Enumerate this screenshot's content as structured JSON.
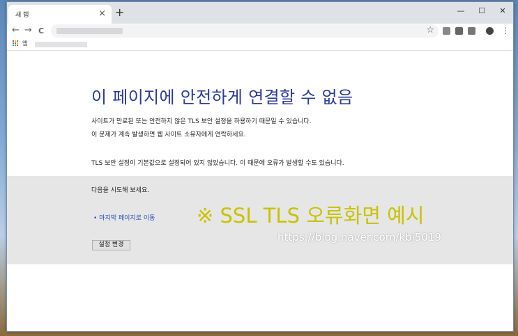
{
  "browser": {
    "tab_title": "새 탭",
    "tab_close": "×",
    "new_tab": "+",
    "back": "←",
    "forward": "→",
    "reload": "C",
    "star": "☆",
    "window_controls": {
      "minimize": "—",
      "maximize": "☐",
      "close": "✕"
    },
    "bookmarks_label": "앱",
    "menu": "⋮"
  },
  "error_page": {
    "title": "이 페이지에 안전하게 연결할 수 없음",
    "line1": "사이트가 만료된 또는 안전하지 않은 TLS 보안 설정을 하용하기 때문일 수 있습니다.",
    "line2": "이 문제가 계속 발생하면 웹 사이트 소유자에게 연락하세요.",
    "line3": "TLS 보안 설정이 기본값으로 설정되어 있지 않았습니다. 이 때문에 오류가 발생할 수도 있습니다.",
    "try_label": "다음을 시도해 보세요.",
    "link_last_page": "• 마지막 페이지로 이동",
    "button_change_settings": "설정 변경"
  },
  "overlay": {
    "caption": "※ SSL TLS 오류화면 예시",
    "watermark": "https://blog.naver.com/kbj5019",
    "caption_color": "#c9c200"
  }
}
